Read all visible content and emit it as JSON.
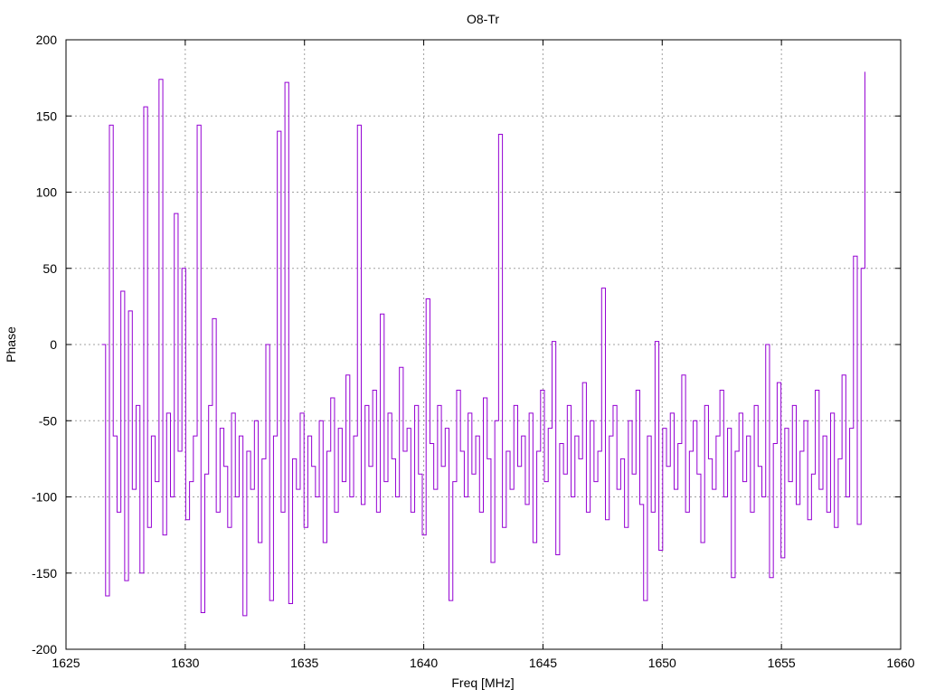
{
  "chart_data": {
    "type": "line",
    "style": "steps",
    "title": "O8-Tr",
    "xlabel": "Freq [MHz]",
    "ylabel": "Phase",
    "xlim": [
      1625,
      1660
    ],
    "ylim": [
      -200,
      200
    ],
    "xticks": [
      1625,
      1630,
      1635,
      1640,
      1645,
      1650,
      1655,
      1660
    ],
    "yticks": [
      -200,
      -150,
      -100,
      -50,
      0,
      50,
      100,
      150,
      200
    ],
    "grid": true,
    "legend": "none",
    "series": [
      {
        "name": "O8-Tr phase",
        "color": "#9400d3",
        "x_start": 1626.5,
        "x_end": 1658.5,
        "values": [
          0,
          -165,
          144,
          -60,
          -110,
          35,
          -155,
          22,
          -95,
          -40,
          -150,
          156,
          -120,
          -60,
          -90,
          174,
          -125,
          -45,
          -100,
          86,
          -70,
          50,
          -115,
          -90,
          -60,
          144,
          -176,
          -85,
          -40,
          17,
          -110,
          -55,
          -80,
          -120,
          -45,
          -100,
          -60,
          -178,
          -70,
          -95,
          -50,
          -130,
          -75,
          0,
          -168,
          -60,
          140,
          -110,
          172,
          -170,
          -75,
          -95,
          -45,
          -120,
          -60,
          -80,
          -100,
          -50,
          -130,
          -70,
          -35,
          -110,
          -55,
          -90,
          -20,
          -100,
          -60,
          144,
          -105,
          -40,
          -80,
          -30,
          -110,
          20,
          -90,
          -45,
          -75,
          -100,
          -15,
          -70,
          -55,
          -110,
          -40,
          -85,
          -125,
          30,
          -65,
          -95,
          -40,
          -80,
          -55,
          -168,
          -90,
          -30,
          -70,
          -100,
          -45,
          -85,
          -60,
          -110,
          -35,
          -75,
          -143,
          -50,
          138,
          -120,
          -70,
          -95,
          -40,
          -80,
          -60,
          -105,
          -45,
          -130,
          -70,
          -30,
          -90,
          -55,
          2,
          -138,
          -65,
          -85,
          -40,
          -100,
          -60,
          -75,
          -25,
          -110,
          -50,
          -90,
          -70,
          37,
          -115,
          -60,
          -40,
          -95,
          -75,
          -120,
          -50,
          -85,
          -30,
          -105,
          -168,
          -60,
          -110,
          2,
          -135,
          -55,
          -80,
          -45,
          -95,
          -65,
          -20,
          -110,
          -70,
          -50,
          -85,
          -130,
          -40,
          -75,
          -95,
          -60,
          -30,
          -100,
          -55,
          -153,
          -70,
          -45,
          -90,
          -60,
          -110,
          -40,
          -80,
          -100,
          0,
          -153,
          -65,
          -25,
          -140,
          -55,
          -90,
          -40,
          -105,
          -70,
          -50,
          -115,
          -85,
          -30,
          -95,
          -60,
          -110,
          -45,
          -120,
          -75,
          -20,
          -100,
          -55,
          58,
          -118,
          50,
          179
        ]
      }
    ]
  }
}
